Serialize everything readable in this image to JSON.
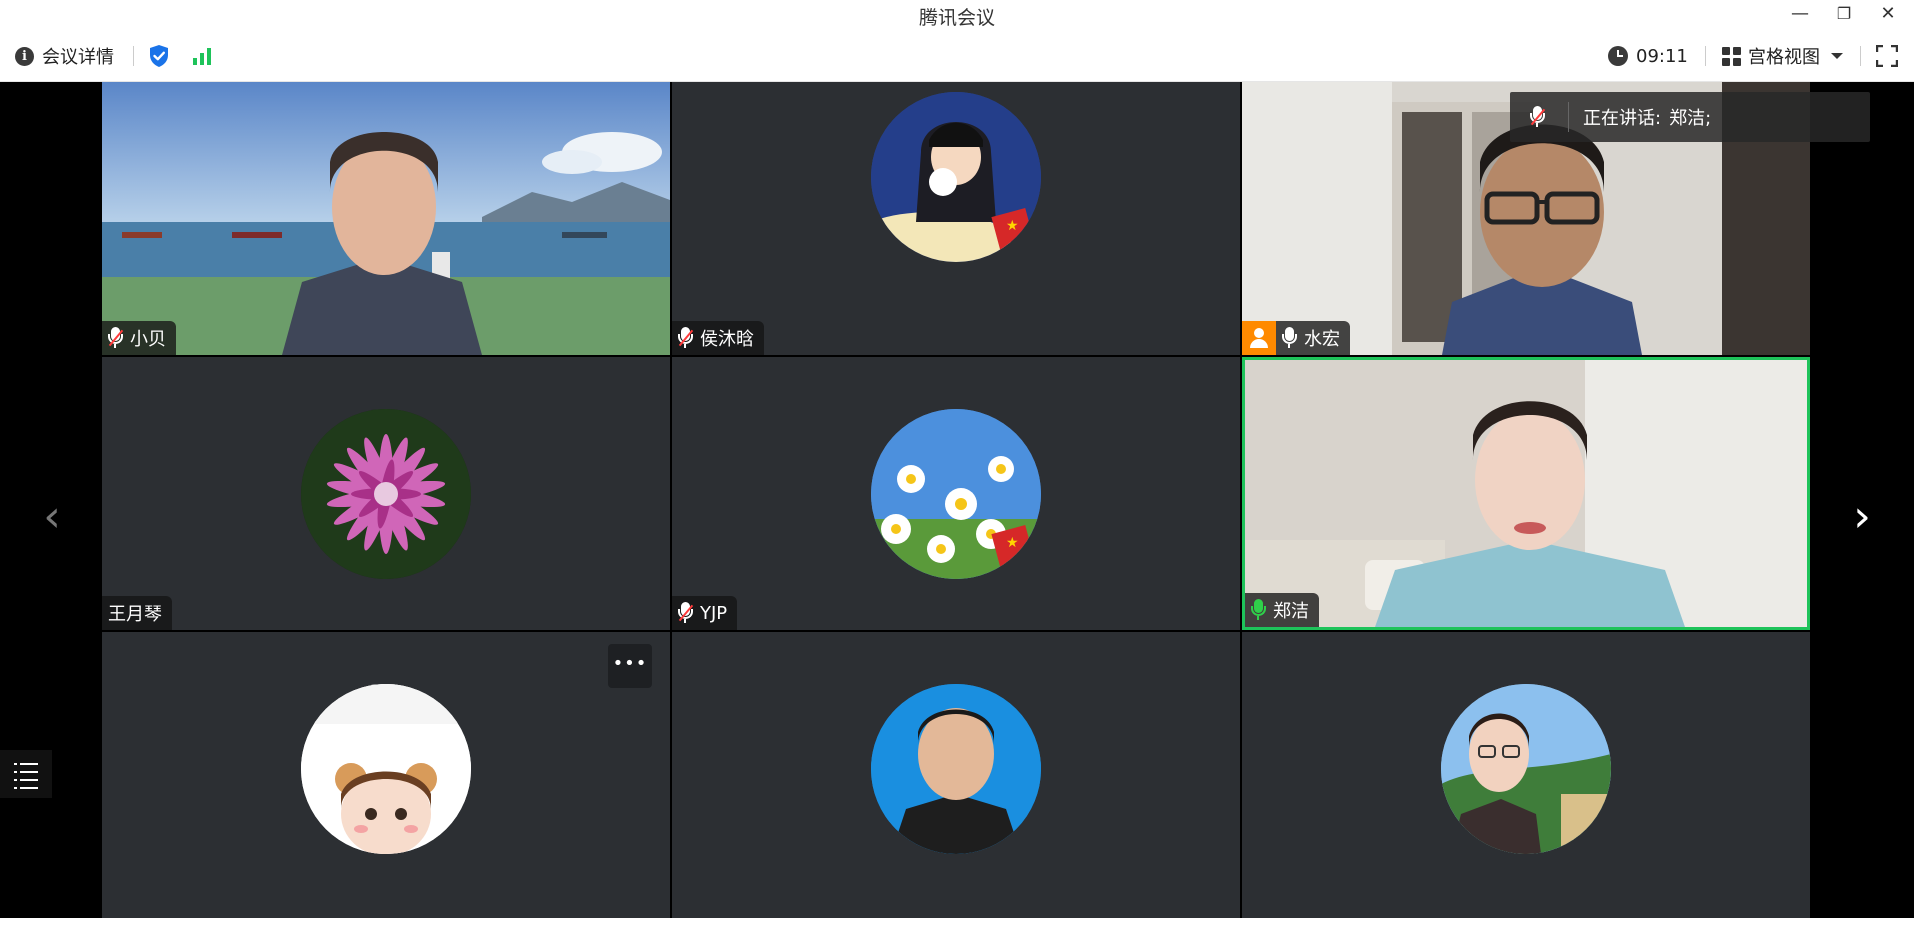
{
  "window": {
    "title": "腾讯会议",
    "minimize": "—",
    "restore": "❐",
    "close": "✕"
  },
  "toolbar": {
    "meeting_details": "会议详情",
    "timer": "09:11",
    "view_mode": "宫格视图",
    "accent_color": "#1a73e8",
    "signal_color": "#1ec35a"
  },
  "speaking_banner": {
    "label": "正在讲话:",
    "names": "郑洁;"
  },
  "participants": [
    {
      "name": "小贝",
      "muted": true,
      "video": true
    },
    {
      "name": "侯沐晗",
      "muted": true,
      "video": false
    },
    {
      "name": "水宏",
      "muted": false,
      "host": true,
      "video": true
    },
    {
      "name": "王月琴",
      "muted": false,
      "video": false
    },
    {
      "name": "YJP",
      "muted": true,
      "video": false
    },
    {
      "name": "郑洁",
      "muted": false,
      "speaking": true,
      "video": true
    },
    {
      "name": "",
      "video": false
    },
    {
      "name": "",
      "video": false
    },
    {
      "name": "",
      "video": false
    }
  ],
  "tile_more": "•••",
  "nav": {
    "prev": "‹",
    "next": "›"
  },
  "colors": {
    "tile_bg": "#2c2f33",
    "active_border": "#1ec35a",
    "host_badge": "#ff8a00"
  }
}
